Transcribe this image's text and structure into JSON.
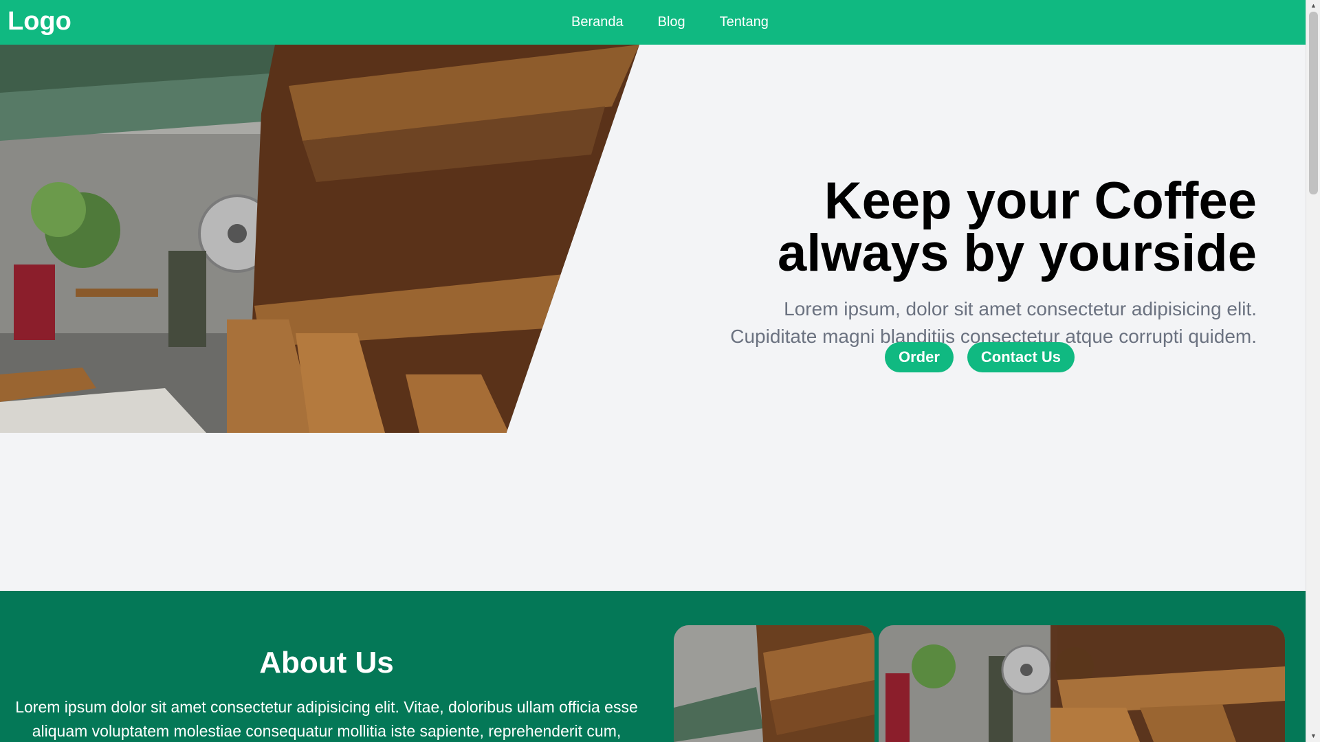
{
  "nav": {
    "logo": "Logo",
    "links": [
      "Beranda",
      "Blog",
      "Tentang"
    ]
  },
  "hero": {
    "title_line1": "Keep your Coffee",
    "title_line2": "always by yourside",
    "desc_line1": "Lorem ipsum, dolor sit amet consectetur adipisicing elit.",
    "desc_line2": "Cupiditate magni blanditiis consectetur atque corrupti quidem.",
    "buttons": {
      "order": "Order",
      "contact": "Contact Us"
    }
  },
  "about": {
    "title": "About Us",
    "text_line1": "Lorem ipsum dolor sit amet consectetur adipisicing elit. Vitae, doloribus ullam officia esse",
    "text_line2": "aliquam voluptatem molestiae consequatur mollitia iste sapiente, reprehenderit cum, rerum"
  },
  "colors": {
    "primary": "#10b981",
    "dark_green": "#047857",
    "background": "#f3f4f6",
    "muted_text": "#6b7280"
  }
}
